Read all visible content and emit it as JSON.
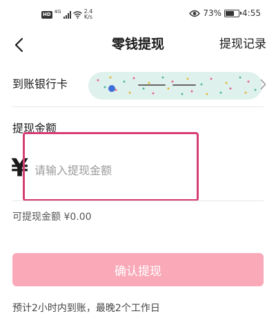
{
  "status_bar": {
    "hd_badge": "HD",
    "network": "4G",
    "speed_value": "2.4",
    "speed_unit": "K/s",
    "battery_text": "73%",
    "battery_level": 0.73,
    "time": "4:55",
    "eye_icon": "eye-icon"
  },
  "header": {
    "back_icon": "chevron-left-icon",
    "title": "零钱提现",
    "history_link": "提现记录"
  },
  "bank_row": {
    "label": "到账银行卡",
    "chevron_icon": "chevron-right-icon"
  },
  "amount": {
    "label": "提现金额",
    "currency_symbol": "¥",
    "placeholder": "请输入提现金额",
    "available_text": "可提现金额 ¥0.00"
  },
  "confirm_button": {
    "label": "确认提现",
    "color": "#f9a9b8"
  },
  "highlight_color": "#d63d74",
  "tip": "预计2小时内到账，最晚2个工作日"
}
